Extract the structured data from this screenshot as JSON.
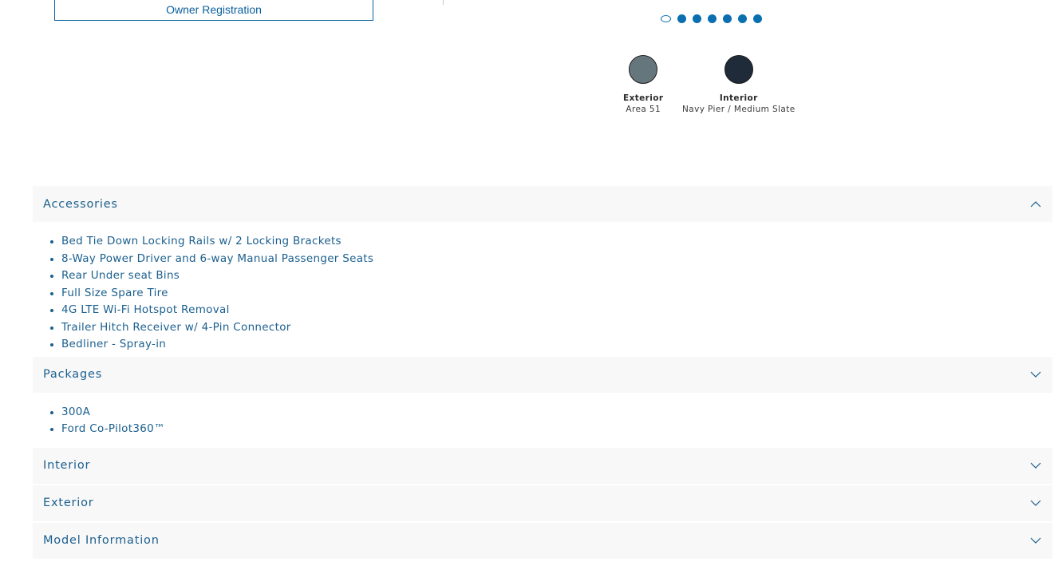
{
  "owner_registration": {
    "label": "Owner Registration"
  },
  "carousel": {
    "dots": [
      {
        "state": "active"
      },
      {
        "state": "inactive"
      },
      {
        "state": "inactive"
      },
      {
        "state": "inactive"
      },
      {
        "state": "inactive"
      },
      {
        "state": "inactive"
      },
      {
        "state": "inactive"
      }
    ]
  },
  "colors": {
    "exterior": {
      "title": "Exterior",
      "value": "Area 51",
      "swatch": "#66767d"
    },
    "interior": {
      "title": "Interior",
      "value": "Navy Pier / Medium Slate",
      "swatch": "#202b3a"
    }
  },
  "accordion": {
    "sections": [
      {
        "title": "Accessories",
        "expanded": true,
        "items": [
          "Bed Tie Down Locking Rails w/ 2 Locking Brackets",
          "8-Way Power Driver and 6-way Manual Passenger Seats",
          "Rear Under seat Bins",
          "Full Size Spare Tire",
          "4G LTE Wi-Fi Hotspot Removal",
          "Trailer Hitch Receiver w/ 4-Pin Connector",
          "Bedliner - Spray-in"
        ]
      },
      {
        "title": "Packages",
        "expanded": false,
        "items": [
          "300A",
          "Ford Co-Pilot360™"
        ]
      },
      {
        "title": "Interior",
        "expanded": false,
        "items": []
      },
      {
        "title": "Exterior",
        "expanded": false,
        "items": []
      },
      {
        "title": "Model Information",
        "expanded": false,
        "items": []
      }
    ]
  },
  "theme": {
    "accent": "#0a6fb0",
    "link_text": "#1b5f8e",
    "header_bg": "#f8f8f8"
  }
}
